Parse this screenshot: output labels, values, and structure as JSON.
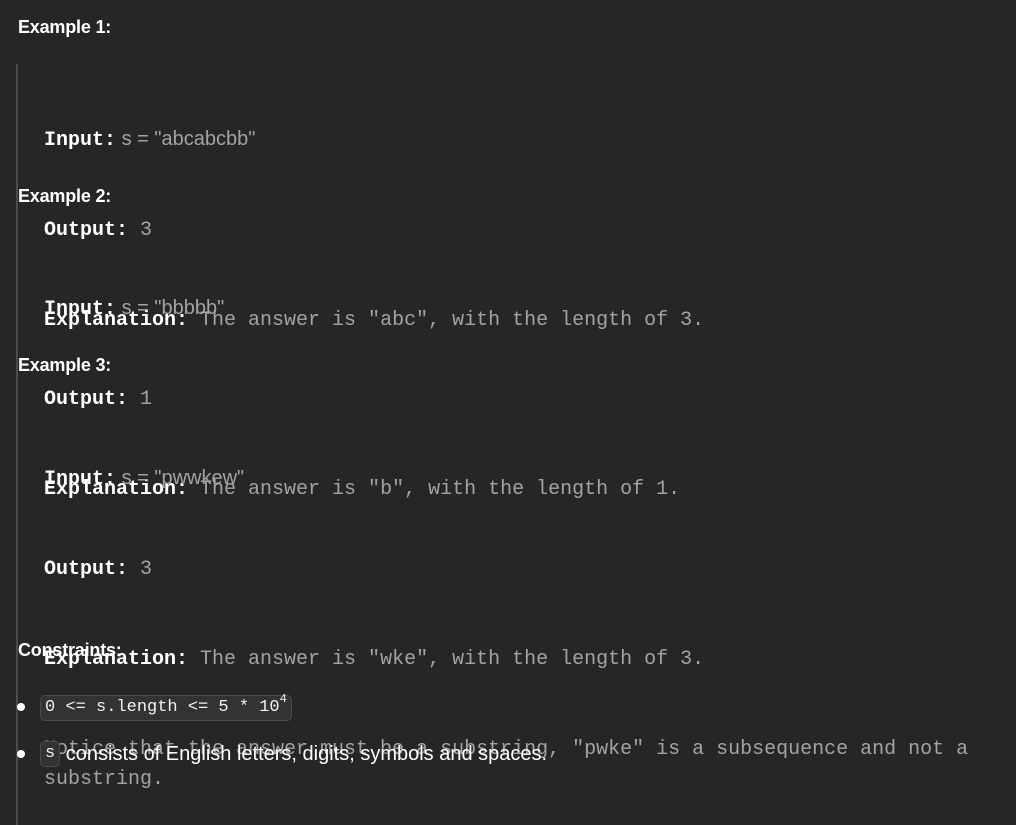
{
  "examples": [
    {
      "heading": "Example 1:",
      "input_label": "Input:",
      "input_value": " s = \"abcabcbb\"",
      "output_label": "Output:",
      "output_value": " 3",
      "explanation_label": "Explanation:",
      "explanation_value": " The answer is \"abc\", with the length of 3.",
      "note": ""
    },
    {
      "heading": "Example 2:",
      "input_label": "Input:",
      "input_value": " s = \"bbbbb\"",
      "output_label": "Output:",
      "output_value": " 1",
      "explanation_label": "Explanation:",
      "explanation_value": " The answer is \"b\", with the length of 1.",
      "note": ""
    },
    {
      "heading": "Example 3:",
      "input_label": "Input:",
      "input_value": " s = \"pwwkew\"",
      "output_label": "Output:",
      "output_value": " 3",
      "explanation_label": "Explanation:",
      "explanation_value": " The answer is \"wke\", with the length of 3.",
      "note": "Notice that the answer must be a substring, \"pwke\" is a subsequence and not a substring."
    }
  ],
  "constraints": {
    "heading": "Constraints:",
    "item1_code": "0 <= s.length <= 5 * 10",
    "item1_exponent": "4",
    "item2_code": "s",
    "item2_text": " consists of English letters, digits, symbols and spaces."
  }
}
